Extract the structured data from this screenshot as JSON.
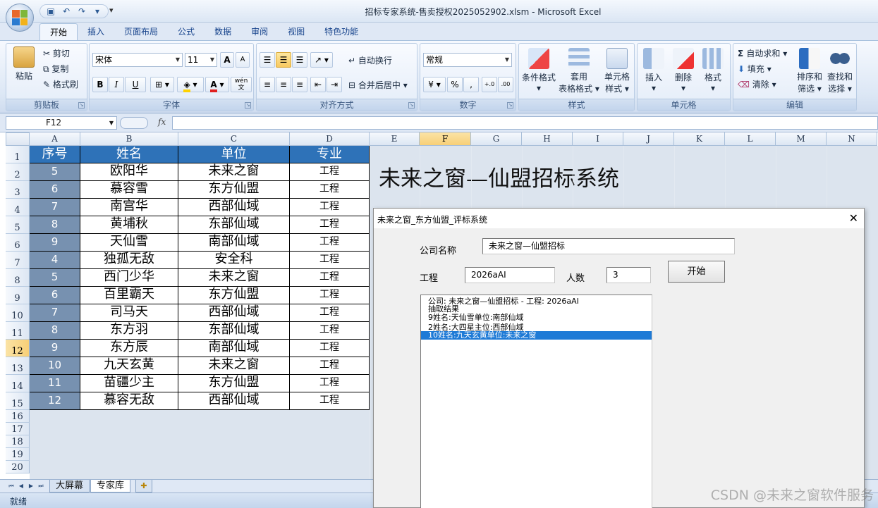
{
  "window": {
    "title": "招标专家系统-售卖授权2025052902.xlsm - Microsoft Excel"
  },
  "ribbon": {
    "tabs": [
      "开始",
      "插入",
      "页面布局",
      "公式",
      "数据",
      "审阅",
      "视图",
      "特色功能"
    ],
    "clipboard": {
      "paste": "粘贴",
      "cut": "剪切",
      "copy": "复制",
      "format_painter": "格式刷",
      "label": "剪贴板"
    },
    "font": {
      "name": "宋体",
      "size": "11",
      "bold": "B",
      "italic": "I",
      "underline": "U",
      "grow": "A",
      "shrink": "A",
      "color_letter": "A",
      "wen": "wén",
      "label": "字体"
    },
    "alignment": {
      "wrap": "自动换行",
      "merge": "合并后居中",
      "label": "对齐方式"
    },
    "number": {
      "format": "常规",
      "percent": "%",
      "comma": ",",
      "inc_dec": "+.0",
      "dec_dec": ".00",
      "label": "数字"
    },
    "styles": {
      "conditional": "条件格式",
      "table_line1": "套用",
      "table_line2": "表格格式",
      "cell_line1": "单元格",
      "cell_line2": "样式",
      "label": "样式"
    },
    "cells": {
      "insert": "插入",
      "delete": "删除",
      "format": "格式",
      "label": "单元格"
    },
    "editing": {
      "autosum": "自动求和",
      "fill": "填充",
      "clear": "清除",
      "sort_line1": "排序和",
      "sort_line2": "筛选",
      "find_line1": "查找和",
      "find_line2": "选择",
      "label": "编辑"
    },
    "colors": {
      "accent": "#2e72b8",
      "highlight": "#ffd200",
      "font_color": "#e02020"
    }
  },
  "formula_bar": {
    "name_box": "F12",
    "fx": "fx",
    "value": ""
  },
  "grid": {
    "columns": [
      "A",
      "B",
      "C",
      "D",
      "E",
      "F",
      "G",
      "H",
      "I",
      "J",
      "K",
      "L",
      "M",
      "N"
    ],
    "selected_column": "F",
    "selected_row": "12",
    "row_numbers": [
      "1",
      "2",
      "3",
      "4",
      "5",
      "6",
      "7",
      "8",
      "9",
      "10",
      "11",
      "12",
      "13",
      "14",
      "15",
      "16",
      "17",
      "18",
      "19",
      "20"
    ],
    "table_headers": [
      "序号",
      "姓名",
      "单位",
      "专业"
    ],
    "table_rows": [
      [
        "5",
        "欧阳华",
        "未来之窗",
        "工程"
      ],
      [
        "6",
        "慕容雪",
        "东方仙盟",
        "工程"
      ],
      [
        "7",
        "南宫华",
        "西部仙域",
        "工程"
      ],
      [
        "8",
        "黄埔秋",
        "东部仙域",
        "工程"
      ],
      [
        "9",
        "天仙雪",
        "南部仙域",
        "工程"
      ],
      [
        "4",
        "独孤无敌",
        "安全科",
        "工程"
      ],
      [
        "5",
        "西门少华",
        "未来之窗",
        "工程"
      ],
      [
        "6",
        "百里霸天",
        "东方仙盟",
        "工程"
      ],
      [
        "7",
        "司马天",
        "西部仙域",
        "工程"
      ],
      [
        "8",
        "东方羽",
        "东部仙域",
        "工程"
      ],
      [
        "9",
        "东方辰",
        "南部仙域",
        "工程"
      ],
      [
        "10",
        "九天玄黄",
        "未来之窗",
        "工程"
      ],
      [
        "11",
        "苗疆少主",
        "东方仙盟",
        "工程"
      ],
      [
        "12",
        "慕容无敌",
        "西部仙域",
        "工程"
      ]
    ],
    "big_title": "未来之窗—仙盟招标系统"
  },
  "sheet_tabs": {
    "tabs": [
      "大屏幕",
      "专家库"
    ],
    "active": "专家库"
  },
  "status": {
    "text": "就绪"
  },
  "dialog": {
    "title": "未来之窗_东方仙盟_评标系统",
    "close": "✕",
    "company_label": "公司名称",
    "company_value": "未来之窗—仙盟招标",
    "project_label": "工程",
    "project_value": "2026aAI",
    "count_label": "人数",
    "count_value": "3",
    "start_button": "开始",
    "results": [
      "公司: 未来之窗—仙盟招标 - 工程: 2026aAI",
      "抽取结果",
      "9姓名:天仙雪单位:南部仙域",
      "2姓名:大四星主位:西部仙域",
      "10姓名:九天玄黄单位:未来之窗"
    ],
    "selected_index": 4
  },
  "watermark": "CSDN @未来之窗软件服务"
}
